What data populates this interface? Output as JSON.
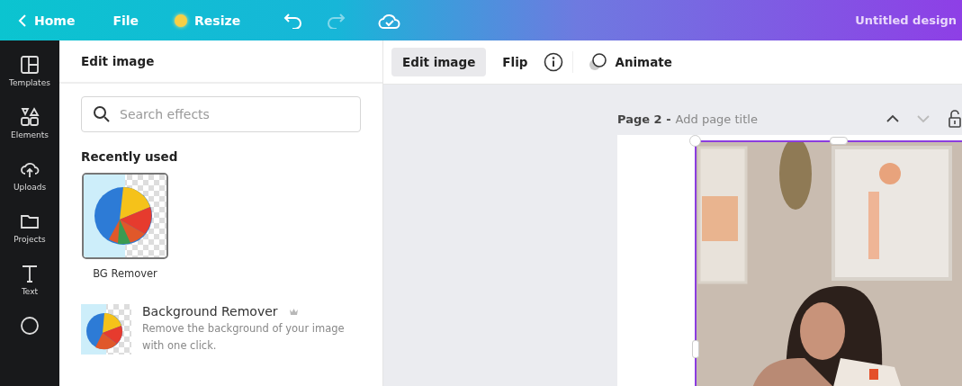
{
  "topbar": {
    "back": "Home",
    "menu": [
      "File"
    ],
    "resize": "Resize",
    "title": "Untitled design"
  },
  "rail": [
    {
      "kind": "templates",
      "label": "Templates"
    },
    {
      "kind": "elements",
      "label": "Elements"
    },
    {
      "kind": "uploads",
      "label": "Uploads"
    },
    {
      "kind": "projects",
      "label": "Projects"
    },
    {
      "kind": "text",
      "label": "Text"
    },
    {
      "kind": "more"
    }
  ],
  "panel": {
    "title": "Edit image",
    "search": {
      "placeholder": "Search effects"
    },
    "recent_heading": "Recently used",
    "recent": [
      {
        "label": "BG Remover",
        "selected": true
      }
    ],
    "effects": [
      {
        "title": "Background Remover",
        "premium": true,
        "description": "Remove the background of your image with one click."
      }
    ]
  },
  "toolbar": {
    "tabs": [
      {
        "label": "Edit image",
        "selected": true
      },
      {
        "label": "Flip",
        "selected": false
      }
    ],
    "animate": "Animate"
  },
  "page": {
    "label": "Page 2 -",
    "title_placeholder": "Add page title"
  }
}
